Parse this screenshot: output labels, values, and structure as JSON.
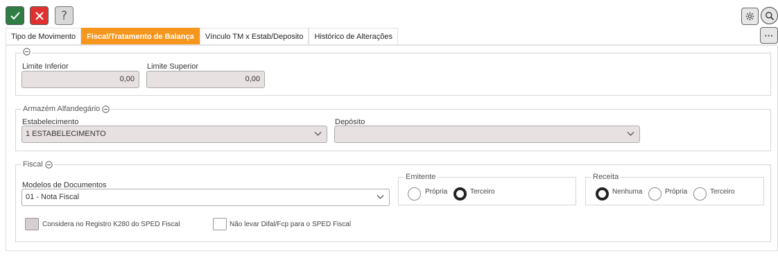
{
  "toolbar": {
    "confirm_icon": "check-icon",
    "cancel_icon": "close-icon",
    "help_label": "?",
    "settings_icon": "gear-icon",
    "search_icon": "search-icon",
    "more_label": "···"
  },
  "tabs": [
    {
      "label": "Tipo de Movimento",
      "active": false
    },
    {
      "label": "Fiscal/Tratamento de Balança",
      "active": true
    },
    {
      "label": "Vínculo TM x Estab/Deposito",
      "active": false
    },
    {
      "label": "Histórico de Alterações",
      "active": false
    }
  ],
  "limits": {
    "lower_label": "Limite Inferior",
    "lower_value": "0,00",
    "upper_label": "Limite Superior",
    "upper_value": "0,00"
  },
  "warehouse": {
    "legend": "Armazém Alfandegário",
    "establishment_label": "Estabelecimento",
    "establishment_value": "1 ESTABELECIMENTO",
    "deposit_label": "Depósito",
    "deposit_value": ""
  },
  "fiscal": {
    "legend": "Fiscal",
    "models_label": "Modelos de Documentos",
    "models_value": "01 - Nota Fiscal",
    "issuer": {
      "legend": "Emitente",
      "options": [
        {
          "label": "Própria",
          "selected": false
        },
        {
          "label": "Terceiro",
          "selected": true
        }
      ]
    },
    "revenue": {
      "legend": "Receita",
      "options": [
        {
          "label": "Nenhuma",
          "selected": true
        },
        {
          "label": "Própria",
          "selected": false
        },
        {
          "label": "Terceiro",
          "selected": false
        }
      ]
    },
    "k280_label": "Considera no Registro K280 do SPED Fiscal",
    "difal_label": "Não levar Difal/Fcp para o SPED Fiscal"
  },
  "colors": {
    "accent_tab": "#f7961d",
    "confirm": "#2f7d42",
    "cancel": "#e03131",
    "readonly_field": "#e8e1e1"
  }
}
